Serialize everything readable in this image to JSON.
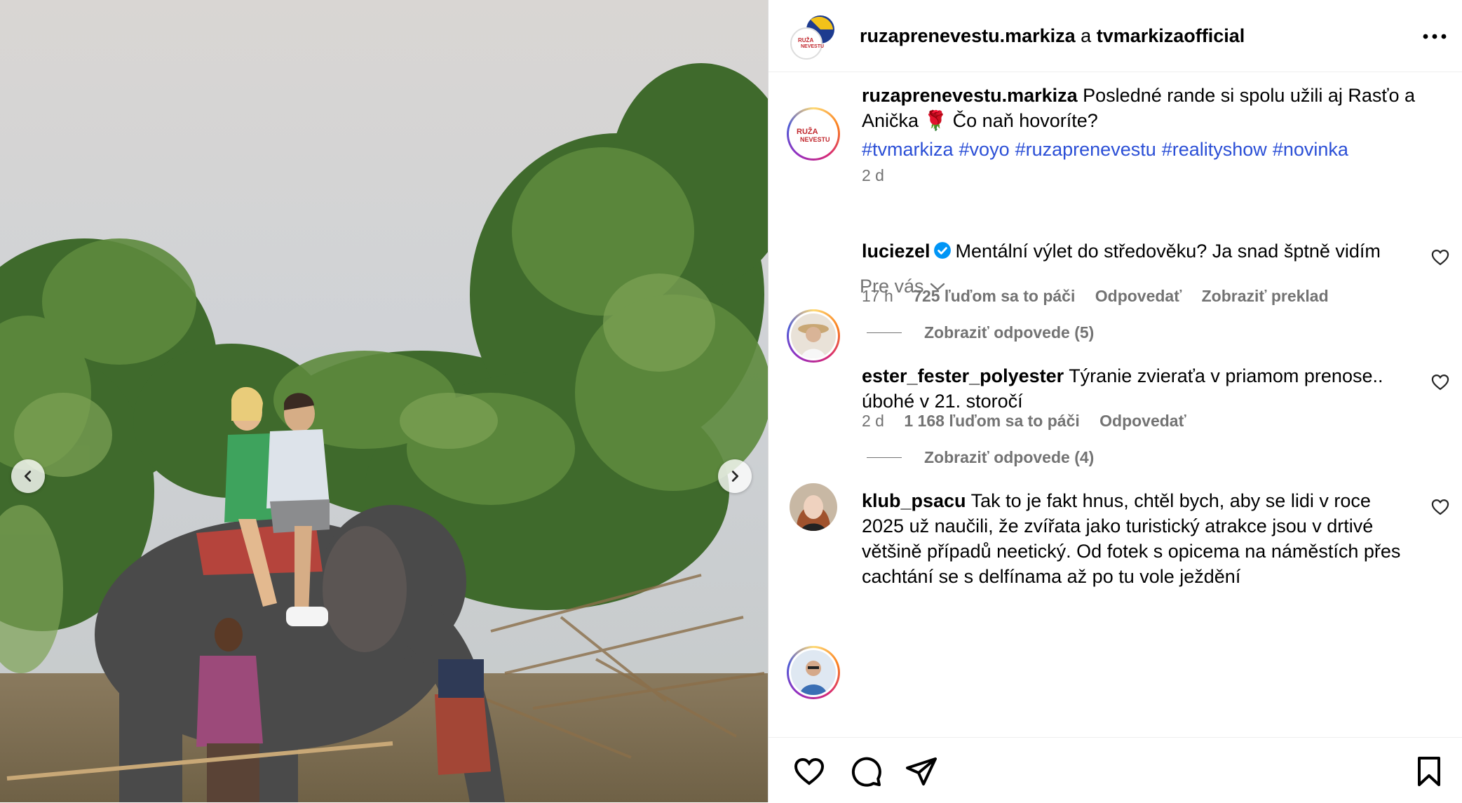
{
  "header": {
    "account": "ruzaprenevestu.markiza",
    "joiner": "a",
    "collaborator": "tvmarkizaofficial",
    "more_icon": "more-horizontal-icon"
  },
  "logo_text": {
    "line1": "RUŽA",
    "line2": "NEVESTU"
  },
  "caption": {
    "username": "ruzaprenevestu.markiza",
    "text": "Posledné rande si spolu užili aj Rasťo a Anička 🌹 Čo naň hovoríte?",
    "hashtags": [
      "#tvmarkiza",
      "#voyo",
      "#ruzaprenevestu",
      "#realityshow",
      "#novinka"
    ],
    "time": "2 d"
  },
  "for_you": {
    "label": "Pre vás"
  },
  "comments": [
    {
      "username": "luciezel",
      "verified": true,
      "text": "Mentální výlet do středověku? Ja snad šptně vidím",
      "time": "17 h",
      "likes": "725 ľuďom sa to páči",
      "reply": "Odpovedať",
      "translate": "Zobraziť preklad",
      "view_replies": "Zobraziť odpovede (5)"
    },
    {
      "username": "ester_fester_polyester",
      "verified": false,
      "text": "Týranie zvieraťa v priamom prenose.. úbohé v 21. storočí",
      "time": "2 d",
      "likes": "1 168 ľuďom sa to páči",
      "reply": "Odpovedať",
      "view_replies": "Zobraziť odpovede (4)"
    },
    {
      "username": "klub_psacu",
      "verified": false,
      "text": "Tak to je fakt hnus, chtěl bych, aby se lidi v roce 2025 už naučili, že zvířata jako turistický atrakce jsou v drtivé většině případů neetický. Od fotek s opicema na náměstích přes cachtání se s delfínama až po tu vole ježdění"
    }
  ],
  "actions": {
    "like_icon": "heart-icon",
    "comment_icon": "comment-icon",
    "share_icon": "share-icon",
    "save_icon": "bookmark-icon"
  },
  "media": {
    "prev_icon": "chevron-left-icon",
    "next_icon": "chevron-right-icon"
  },
  "colors": {
    "link": "#2b4fd6",
    "muted": "#737373",
    "verified": "#0095f6"
  }
}
